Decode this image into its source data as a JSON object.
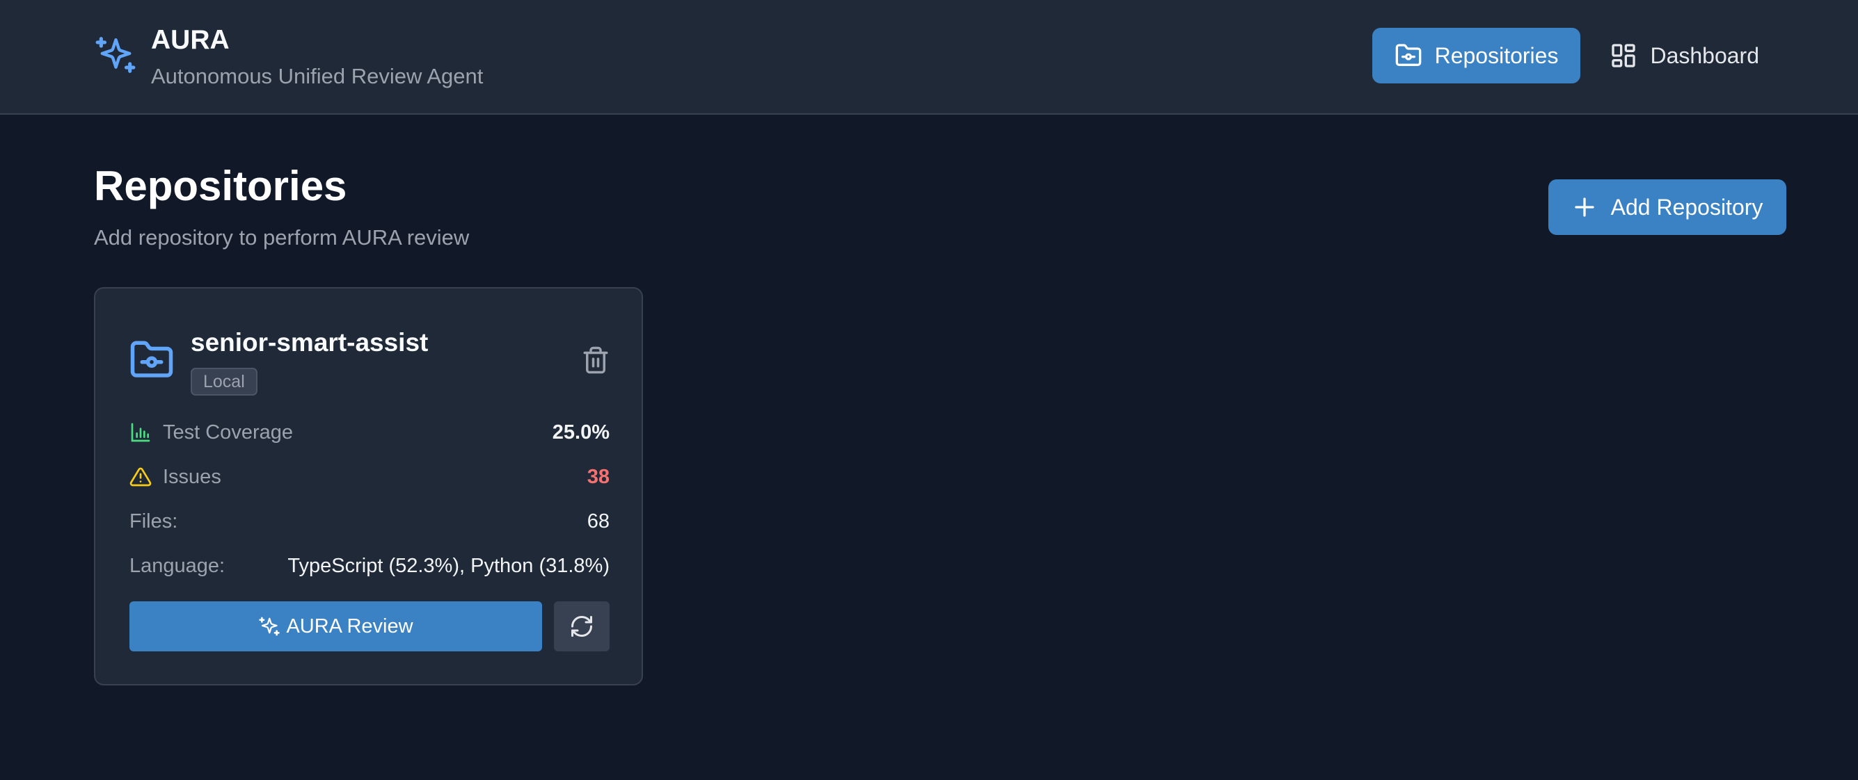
{
  "app": {
    "title": "AURA",
    "subtitle": "Autonomous Unified Review Agent",
    "logo_icon": "sparkles-icon",
    "accent": "#3b82c4"
  },
  "nav": {
    "items": [
      {
        "label": "Repositories",
        "icon": "folder-git-icon",
        "active": true
      },
      {
        "label": "Dashboard",
        "icon": "layout-dashboard-icon",
        "active": false
      }
    ]
  },
  "page": {
    "title": "Repositories",
    "subtitle": "Add repository to perform AURA review",
    "add_button": "Add Repository"
  },
  "repositories": [
    {
      "name": "senior-smart-assist",
      "badge": "Local",
      "stats": {
        "coverage_label": "Test Coverage",
        "coverage_value": "25.0%",
        "issues_label": "Issues",
        "issues_value": "38",
        "files_label": "Files:",
        "files_value": "68",
        "language_label": "Language:",
        "language_value": "TypeScript (52.3%), Python (31.8%)"
      },
      "review_button": "AURA Review",
      "colors": {
        "coverage_icon": "#4ade80",
        "issues_icon": "#facc15",
        "issues_value": "#f87171"
      }
    }
  ]
}
